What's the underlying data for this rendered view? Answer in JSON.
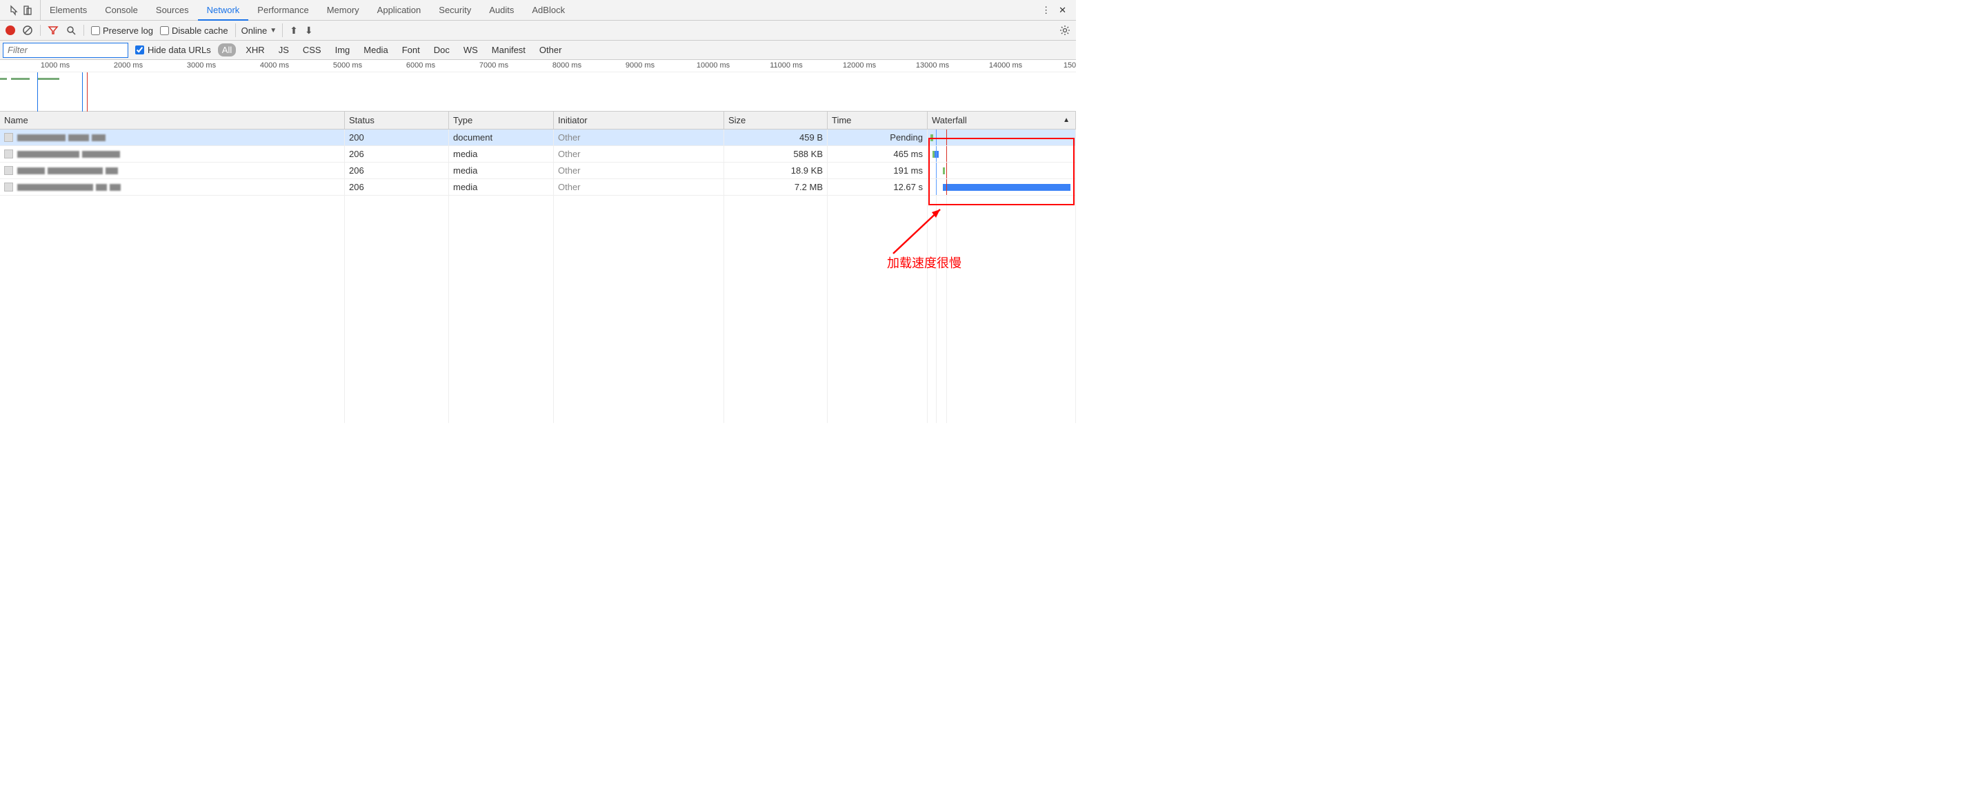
{
  "tabs": [
    "Elements",
    "Console",
    "Sources",
    "Network",
    "Performance",
    "Memory",
    "Application",
    "Security",
    "Audits",
    "AdBlock"
  ],
  "active_tab": "Network",
  "toolbar": {
    "preserve_log": "Preserve log",
    "disable_cache": "Disable cache",
    "throttle": "Online"
  },
  "filter_bar": {
    "placeholder": "Filter",
    "hide_data_urls": "Hide data URLs",
    "types": [
      "All",
      "XHR",
      "JS",
      "CSS",
      "Img",
      "Media",
      "Font",
      "Doc",
      "WS",
      "Manifest",
      "Other"
    ],
    "active_type": "All"
  },
  "timeline": {
    "ticks": [
      "1000 ms",
      "2000 ms",
      "3000 ms",
      "4000 ms",
      "5000 ms",
      "6000 ms",
      "7000 ms",
      "8000 ms",
      "9000 ms",
      "10000 ms",
      "11000 ms",
      "12000 ms",
      "13000 ms",
      "14000 ms",
      "150"
    ]
  },
  "columns": {
    "name": "Name",
    "status": "Status",
    "type": "Type",
    "initiator": "Initiator",
    "size": "Size",
    "time": "Time",
    "waterfall": "Waterfall"
  },
  "rows": [
    {
      "status": "200",
      "type": "document",
      "initiator": "Other",
      "size": "459 B",
      "time": "Pending"
    },
    {
      "status": "206",
      "type": "media",
      "initiator": "Other",
      "size": "588 KB",
      "time": "465 ms"
    },
    {
      "status": "206",
      "type": "media",
      "initiator": "Other",
      "size": "18.9 KB",
      "time": "191 ms"
    },
    {
      "status": "206",
      "type": "media",
      "initiator": "Other",
      "size": "7.2 MB",
      "time": "12.67 s"
    }
  ],
  "annotation": "加载速度很慢"
}
